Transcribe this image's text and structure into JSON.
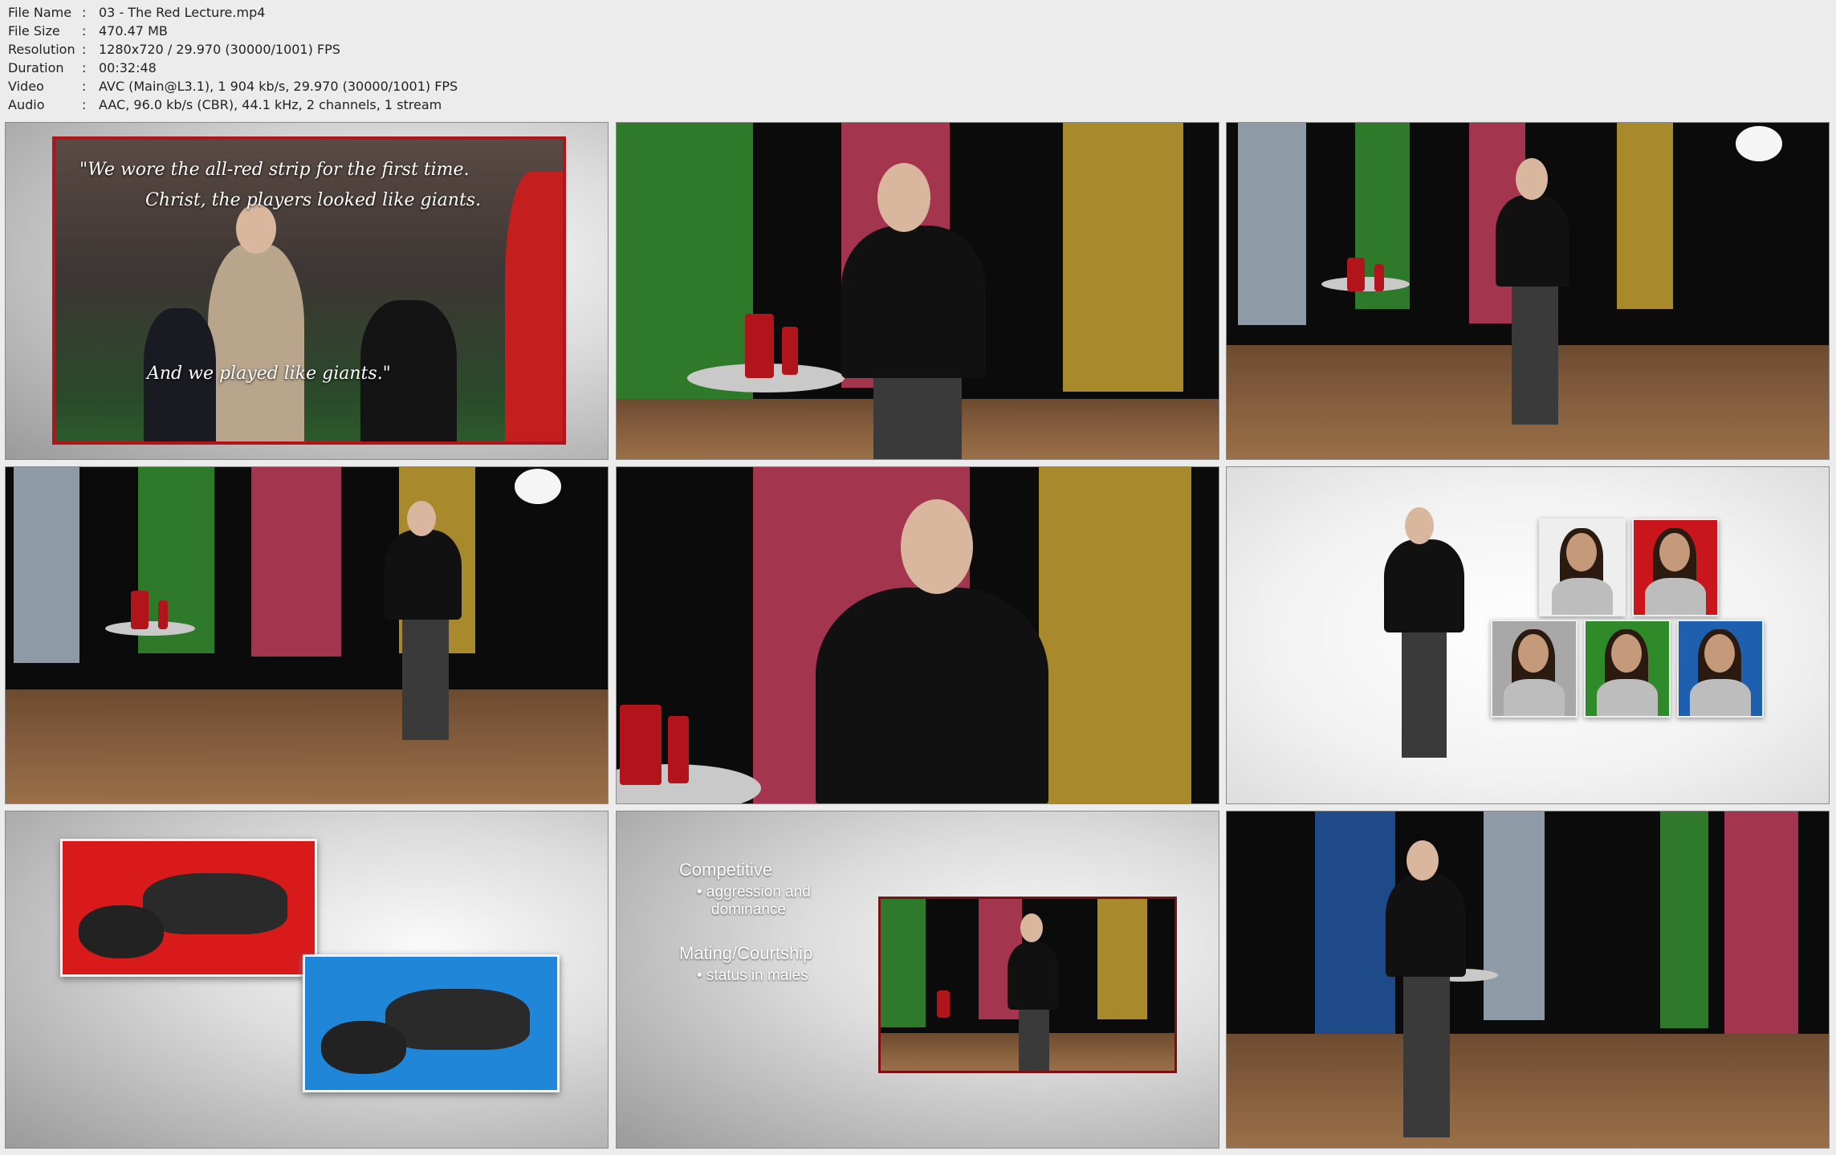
{
  "info": {
    "file_name_label": "File Name",
    "file_name_value": "03 - The Red Lecture.mp4",
    "file_size_label": "File Size",
    "file_size_value": "470.47 MB",
    "resolution_label": "Resolution",
    "resolution_value": "1280x720 / 29.970 (30000/1001) FPS",
    "duration_label": "Duration",
    "duration_value": "00:32:48",
    "video_label": "Video",
    "video_value": "AVC (Main@L3.1), 1 904 kb/s, 29.970 (30000/1001) FPS",
    "audio_label": "Audio",
    "audio_value": "AAC, 96.0 kb/s (CBR), 44.1 kHz, 2 channels, 1 stream",
    "separator": ":"
  },
  "thumb1": {
    "quote_line1": "\"We wore the all-red strip for the first time.",
    "quote_line2": "Christ, the players looked like giants.",
    "quote_line3": "And we played like giants.\""
  },
  "thumb8": {
    "heading1": "Competitive",
    "bullet1": "• aggression and",
    "bullet1b": "dominance",
    "heading2": "Mating/Courtship",
    "bullet2": "• status in males"
  },
  "colors": {
    "red": "#b1141a",
    "green": "#2f7a2a",
    "pink": "#a3354e",
    "gold": "#a88a2c",
    "blue": "#1f4a8a",
    "gray_panel": "#8e9aa6"
  }
}
